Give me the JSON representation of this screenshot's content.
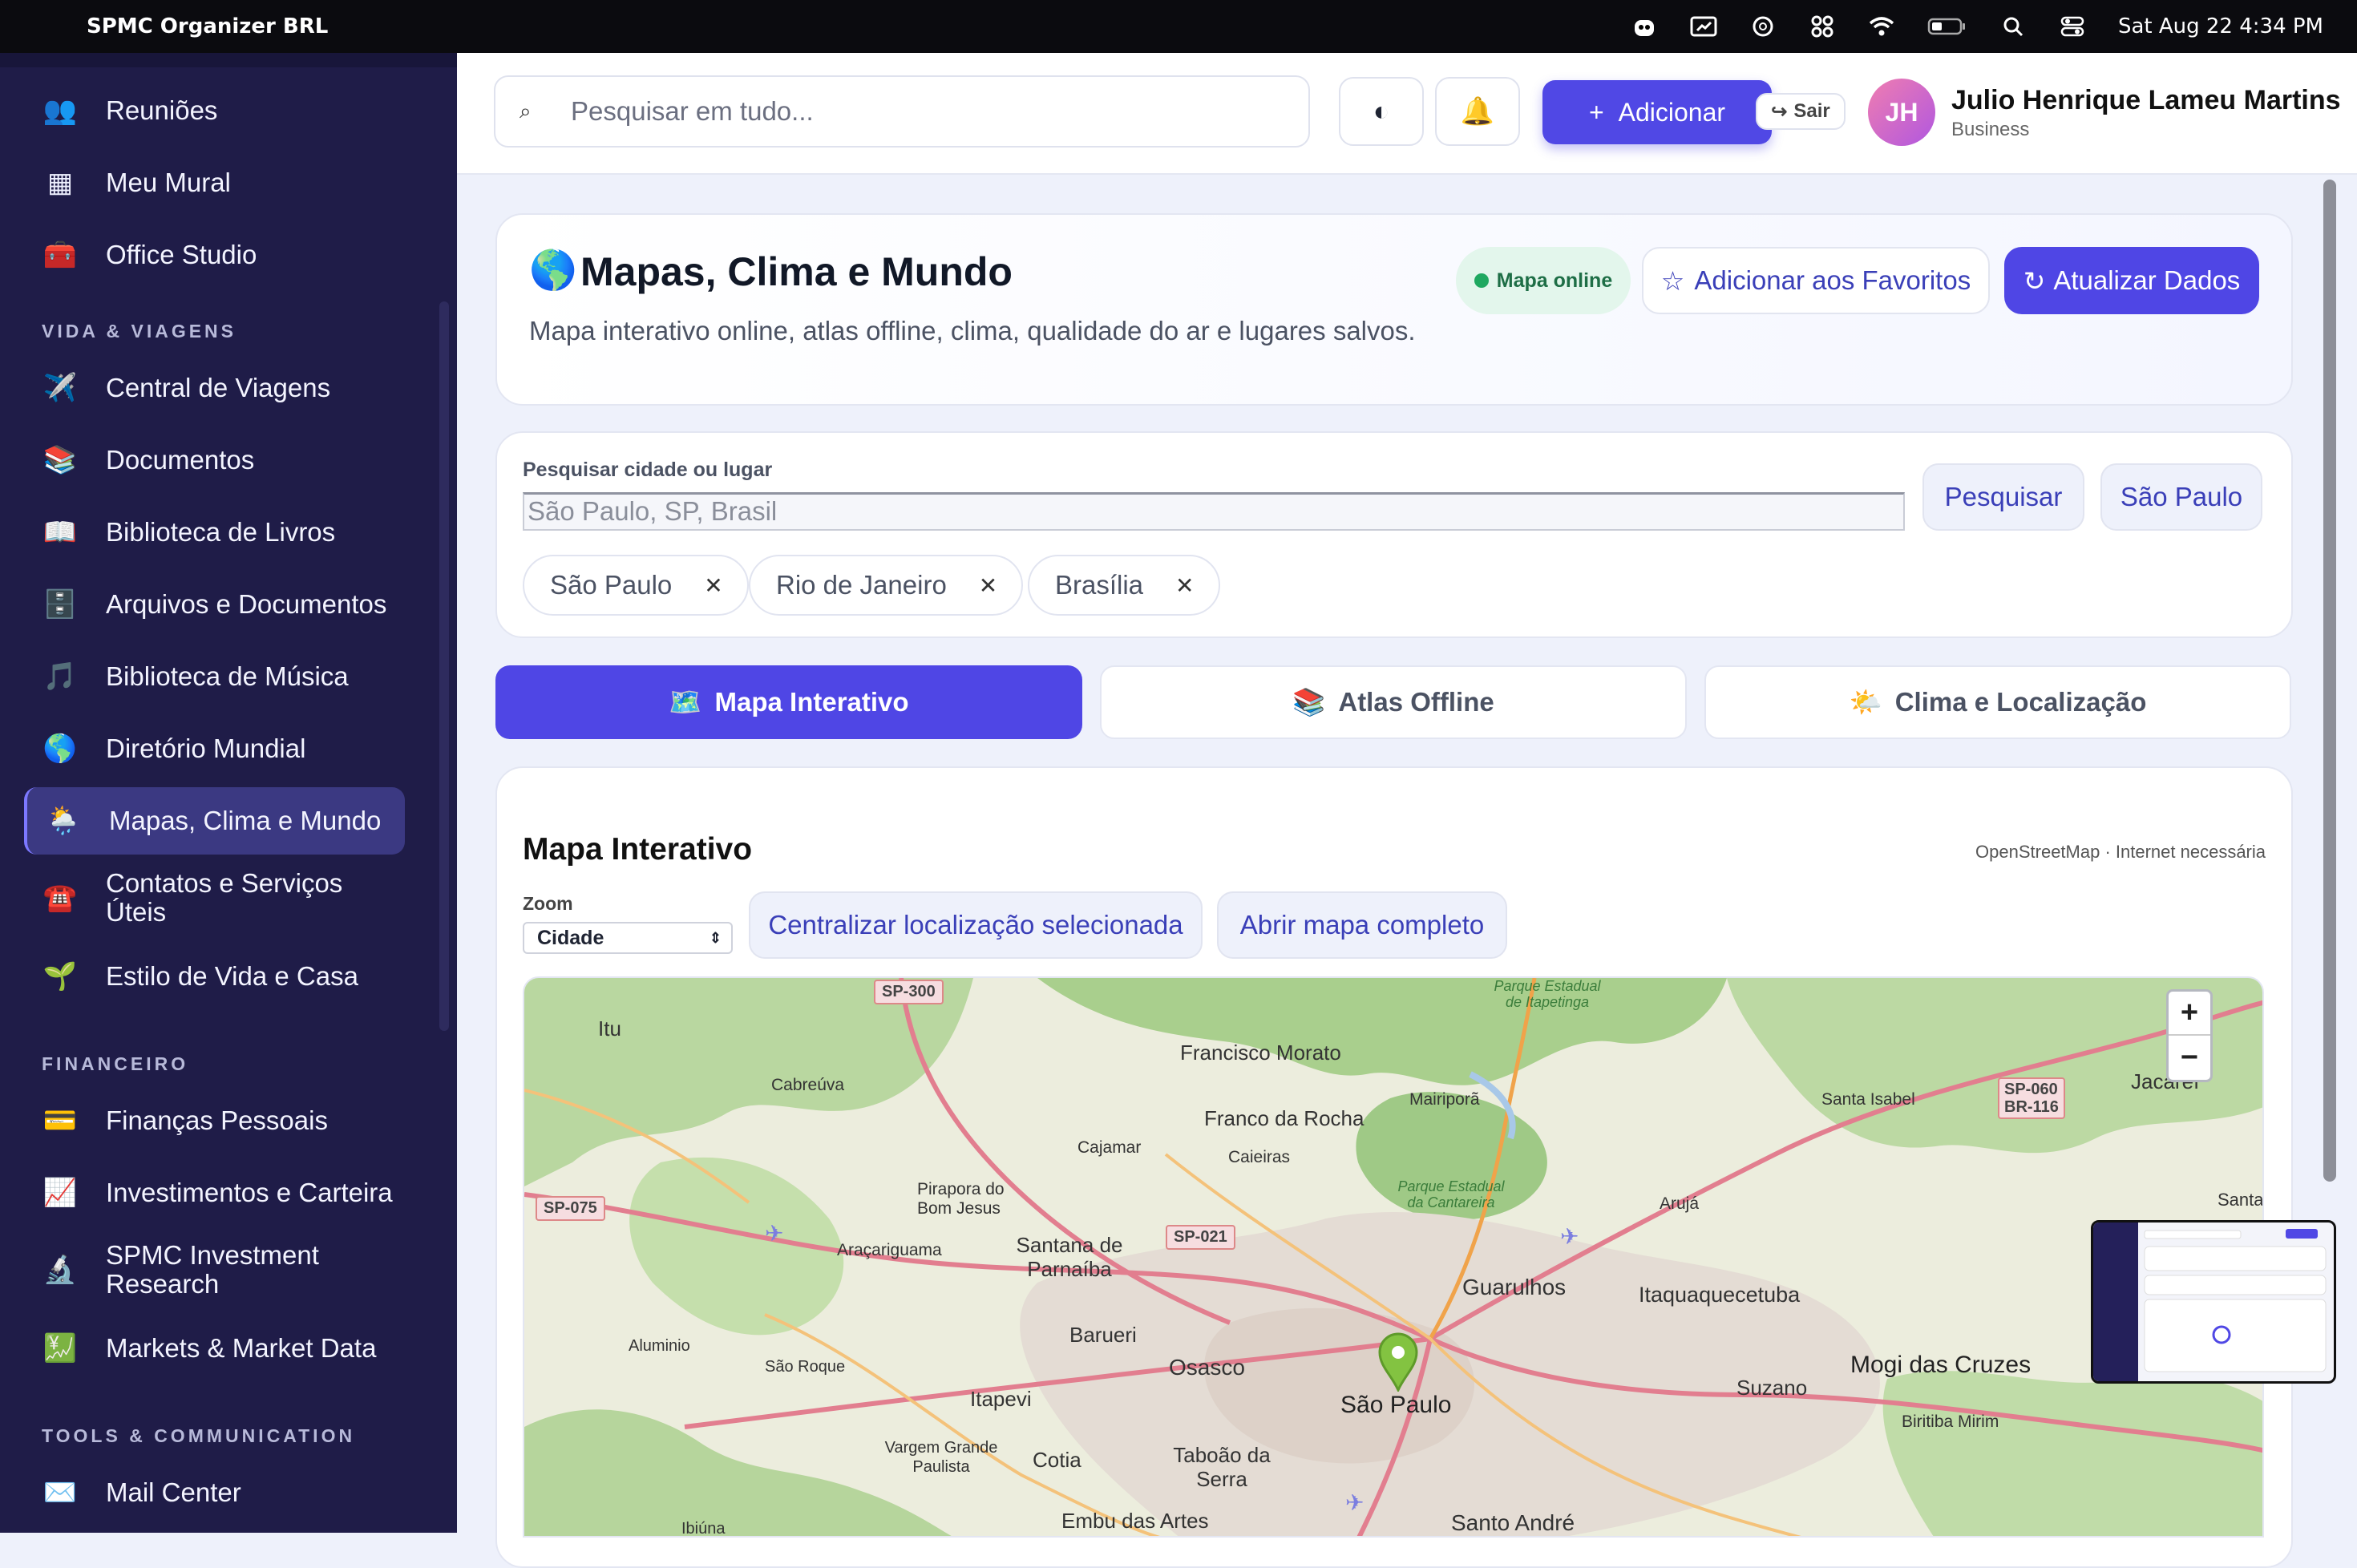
{
  "menubar": {
    "app_name": "SPMC Organizer BRL",
    "datetime": "Sat Aug 22  4:34 PM"
  },
  "sidebar": {
    "items_top": [
      {
        "label": "Reuniões",
        "icon": "👥"
      },
      {
        "label": "Meu Mural",
        "icon": "▦"
      },
      {
        "label": "Office Studio",
        "icon": "🧰"
      }
    ],
    "section_vida": "VIDA & VIAGENS",
    "items_vida": [
      {
        "label": "Central de Viagens",
        "icon": "✈️"
      },
      {
        "label": "Documentos",
        "icon": "📚"
      },
      {
        "label": "Biblioteca de Livros",
        "icon": "📖"
      },
      {
        "label": "Arquivos e Documentos",
        "icon": "🗄️"
      },
      {
        "label": "Biblioteca de Música",
        "icon": "🎵"
      },
      {
        "label": "Diretório Mundial",
        "icon": "🌎"
      },
      {
        "label": "Mapas, Clima e Mundo",
        "icon": "🌦️"
      },
      {
        "label": "Contatos e Serviços Úteis",
        "icon": "☎️"
      },
      {
        "label": "Estilo de Vida e Casa",
        "icon": "🌱"
      }
    ],
    "section_fin": "FINANCEIRO",
    "items_fin": [
      {
        "label": "Finanças Pessoais",
        "icon": "💳"
      },
      {
        "label": "Investimentos e Carteira",
        "icon": "📈"
      },
      {
        "label": "SPMC Investment Research",
        "icon": "🔬"
      },
      {
        "label": "Markets & Market Data",
        "icon": "💹"
      }
    ],
    "section_tools": "TOOLS & COMMUNICATION",
    "items_tools": [
      {
        "label": "Mail Center",
        "icon": "✉️"
      }
    ]
  },
  "topbar": {
    "search_placeholder": "Pesquisar em tudo...",
    "add_label": "Adicionar",
    "logout_label": "Sair",
    "avatar_initials": "JH",
    "user_name": "Julio Henrique Lameu Martins",
    "user_role": "Business"
  },
  "hero": {
    "icon": "🌎",
    "title": "Mapas, Clima e Mundo",
    "subtitle": "Mapa interativo online, atlas offline, clima, qualidade do ar e lugares salvos.",
    "status_badge": "Mapa online",
    "favorite_label": "Adicionar aos Favoritos",
    "refresh_label": "Atualizar Dados"
  },
  "search_place": {
    "label": "Pesquisar cidade ou lugar",
    "placeholder": "São Paulo, SP, Brasil",
    "search_button": "Pesquisar",
    "quick_button": "São Paulo",
    "chips": [
      "São Paulo",
      "Rio de Janeiro",
      "Brasília"
    ]
  },
  "tabs": [
    {
      "label": "Mapa Interativo",
      "icon": "🗺️"
    },
    {
      "label": "Atlas Offline",
      "icon": "📚"
    },
    {
      "label": "Clima e Localização",
      "icon": "🌤️"
    }
  ],
  "map_card": {
    "title": "Mapa Interativo",
    "attribution": "OpenStreetMap · Internet necessária",
    "zoom_label": "Zoom",
    "zoom_value": "Cidade",
    "center_button": "Centralizar localização selecionada",
    "open_button": "Abrir mapa completo"
  },
  "map_labels": {
    "places": [
      "Itu",
      "Cabreúva",
      "Francisco Morato",
      "Franco da Rocha",
      "Mairiporã",
      "Caieiras",
      "Cajamar",
      "Santa Isabel",
      "Jacareí",
      "Pirapora do Bom Jesus",
      "Araçariguama",
      "Santana de Parnaíba",
      "Arujá",
      "Guarulhos",
      "Itaquaquecetuba",
      "Barueri",
      "Osasco",
      "Aluminio",
      "São Roque",
      "Itapevi",
      "São Paulo",
      "Suzano",
      "Mogi das Cruzes",
      "Vargem Grande Paulista",
      "Cotia",
      "Taboão da Serra",
      "Embu das Artes",
      "Santo André",
      "Biritiba Mirim",
      "Ibiúna",
      "Santa"
    ],
    "roads": [
      "SP-300",
      "SP-075",
      "SP-021",
      "SP-060 BR-116"
    ],
    "park": "Parque Estadual da Cantareira",
    "park2": "Parque Estadual de Itapetinga"
  }
}
